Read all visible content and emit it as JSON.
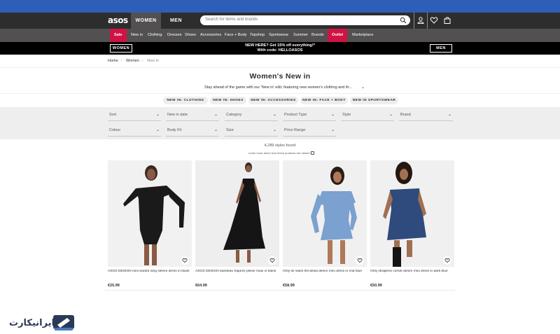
{
  "header": {
    "logo": "asos",
    "gender_tabs": [
      "WOMEN",
      "MEN"
    ],
    "search_placeholder": "Search for items and brands"
  },
  "nav": {
    "items": [
      "Sale",
      "New in",
      "Clothing",
      "Dresses",
      "Shoes",
      "Accessories",
      "Face + Body",
      "Topshop",
      "Sportswear",
      "Summer",
      "Brands",
      "Outlet",
      "Marketplace"
    ]
  },
  "promo": {
    "left_button": "WOMEN",
    "right_button": "MEN",
    "line1": "NEW HERE? Get 15% off everything!*",
    "line2": "With code: HELLOASOS"
  },
  "breadcrumb": [
    "Home",
    "Women",
    "New in"
  ],
  "page": {
    "title": "Women's New in",
    "subtitle": "Stay ahead of the game with our 'New in' edit, featuring new women's clothing and th..."
  },
  "chips": [
    "NEW IN: CLOTHING",
    "NEW IN: SHOES",
    "NEW IN: ACCESSORIES",
    "NEW IN: FACE + BODY",
    "NEW IN SPORTSWEAR"
  ],
  "filters": [
    [
      "Sort",
      "New in date",
      "Category",
      "Product Type",
      "Style",
      "Brand"
    ],
    [
      "Colour",
      "Body Fit",
      "Size",
      "Price Range"
    ]
  ],
  "results": {
    "count": "4,289 styles found",
    "learn_more": "Learn more about how these products are ranked"
  },
  "products": [
    {
      "name": "ASOS DESIGN mini bardot long sleeve dress in black",
      "price": "€25.99",
      "color": "#1a1a1a",
      "bg": "#f1f1f1"
    },
    {
      "name": "ASOS DESIGN bandeau trapeze plisse maxi in black",
      "price": "€64.99",
      "color": "#151515",
      "bg": "#eeeeee"
    },
    {
      "name": "Only tie waist frill detail denim mini dress in mid blue",
      "price": "€58.99",
      "color": "#7aa1cf",
      "bg": "#f0f0f0"
    },
    {
      "name": "Only strapless corset denim mini dress in dark blue",
      "price": "€50.99",
      "color": "#2f4a7d",
      "bg": "#f0f0f0"
    }
  ],
  "watermark": {
    "text": "ایرانیکارت"
  },
  "colors": {
    "brand_dark": "#2d2d2d",
    "sale_pink": "#d01345",
    "top_blue": "#2d5fb8"
  }
}
